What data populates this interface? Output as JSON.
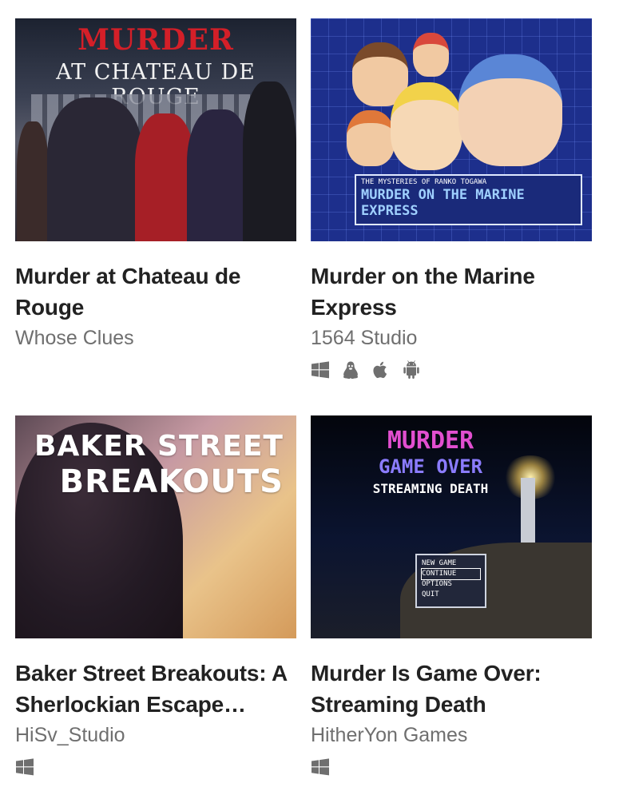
{
  "games": [
    {
      "title": "Murder at Chateau de Rouge",
      "author": "Whose Clues",
      "art": {
        "line1": "MURDER",
        "line2": "AT CHATEAU DE ROUGE"
      },
      "platforms": []
    },
    {
      "title": "Murder on the Marine Express",
      "author": "1564 Studio",
      "art": {
        "line1": "THE MYSTERIES OF RANKO TOGAWA",
        "line2": "MURDER ON THE MARINE EXPRESS"
      },
      "platforms": [
        "windows-icon",
        "linux-icon",
        "apple-icon",
        "android-icon"
      ]
    },
    {
      "title": "Baker Street Breakouts: A Sherlockian Escape…",
      "author": "HiSv_Studio",
      "art": {
        "line1": "BAKER STREET",
        "line2": "BREAKOUTS"
      },
      "platforms": [
        "windows-icon"
      ]
    },
    {
      "title": "Murder Is Game Over: Streaming Death",
      "author": "HitherYon Games",
      "art": {
        "line1": "MURDER",
        "line2": "GAME OVER",
        "line3": "STREAMING DEATH",
        "menu": [
          "NEW GAME",
          "CONTINUE",
          "OPTIONS",
          "QUIT"
        ]
      },
      "platforms": [
        "windows-icon"
      ]
    }
  ]
}
